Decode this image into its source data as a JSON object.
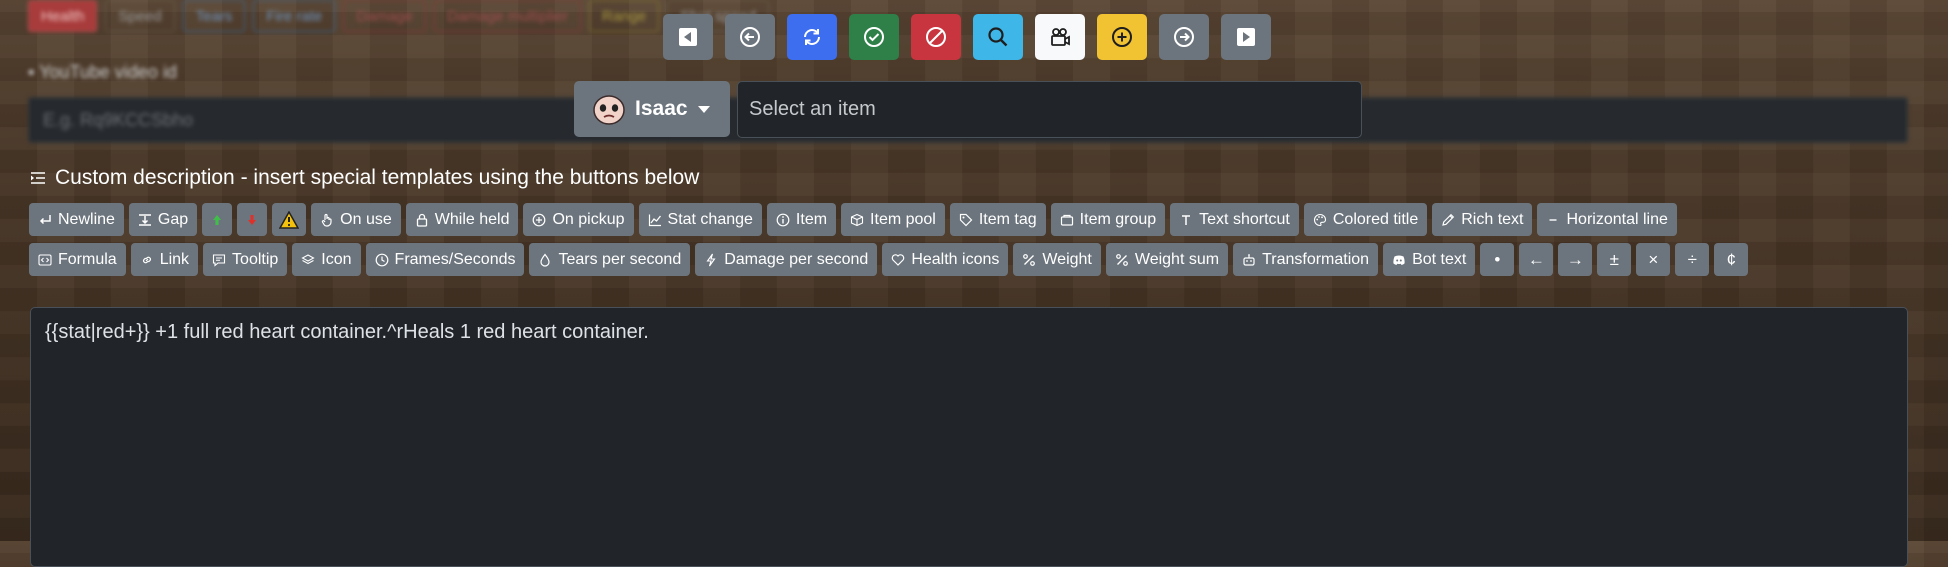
{
  "background": {
    "tags": [
      {
        "label": "Health",
        "style": "red"
      },
      {
        "label": "Speed",
        "style": "plain"
      },
      {
        "label": "Tears",
        "style": "blue"
      },
      {
        "label": "Fire rate",
        "style": "blue"
      },
      {
        "label": "Damage",
        "style": "redo"
      },
      {
        "label": "Damage multiplier",
        "style": "redo"
      },
      {
        "label": "Range",
        "style": "yellow"
      },
      {
        "label": "Shot speed",
        "style": "plain"
      }
    ],
    "youtube_label": "YouTube video id",
    "youtube_placeholder": "E.g. Rq9KCCSbho"
  },
  "toolbar": {
    "buttons": [
      {
        "name": "first-item",
        "icon": "skip-back-icon",
        "color": "#6c757d"
      },
      {
        "name": "previous-item",
        "icon": "arrow-left-circle-icon",
        "color": "#6c757d"
      },
      {
        "name": "reload",
        "icon": "refresh-icon",
        "color": "#3d6ef0"
      },
      {
        "name": "approve",
        "icon": "check-circle-icon",
        "color": "#2e8048"
      },
      {
        "name": "reject",
        "icon": "ban-icon",
        "color": "#c9353f"
      },
      {
        "name": "search",
        "icon": "search-icon",
        "color": "#3fb6e8"
      },
      {
        "name": "video",
        "icon": "camera-reels-icon",
        "color": "#f8f9fa"
      },
      {
        "name": "add",
        "icon": "plus-circle-icon",
        "color": "#f1c232"
      },
      {
        "name": "next-item",
        "icon": "arrow-right-circle-icon",
        "color": "#6c757d"
      },
      {
        "name": "last-item",
        "icon": "skip-forward-icon",
        "color": "#6c757d"
      }
    ]
  },
  "character": {
    "name": "Isaac",
    "icon": "isaac-face-icon"
  },
  "item_select": {
    "placeholder": "Select an item"
  },
  "description": {
    "title": "Custom description - insert special templates using the buttons below",
    "text": "{{stat|red+}} +1 full red heart container.^rHeals 1 red heart container."
  },
  "templates": {
    "row1": [
      {
        "label": "Newline",
        "icon": "newline-icon"
      },
      {
        "label": "Gap",
        "icon": "gap-icon"
      },
      {
        "label": "",
        "icon": "arrow-up-green-icon"
      },
      {
        "label": "",
        "icon": "arrow-down-red-icon"
      },
      {
        "label": "",
        "icon": "warning-icon"
      },
      {
        "label": "On use",
        "icon": "hand-icon"
      },
      {
        "label": "While held",
        "icon": "lock-icon"
      },
      {
        "label": "On pickup",
        "icon": "plus-circle-icon"
      },
      {
        "label": "Stat change",
        "icon": "graph-icon"
      },
      {
        "label": "Item",
        "icon": "info-icon"
      },
      {
        "label": "Item pool",
        "icon": "box-icon"
      },
      {
        "label": "Item tag",
        "icon": "tag-icon"
      },
      {
        "label": "Item group",
        "icon": "folder-icon"
      },
      {
        "label": "Text shortcut",
        "icon": "t-icon"
      },
      {
        "label": "Colored title",
        "icon": "palette-icon"
      },
      {
        "label": "Rich text",
        "icon": "pencil-icon"
      },
      {
        "label": "Horizontal line",
        "icon": "dash-icon"
      }
    ],
    "row2": [
      {
        "label": "Formula",
        "icon": "code-icon"
      },
      {
        "label": "Link",
        "icon": "link-icon"
      },
      {
        "label": "Tooltip",
        "icon": "chat-icon"
      },
      {
        "label": "Icon",
        "icon": "layers-icon"
      },
      {
        "label": "Frames/Seconds",
        "icon": "clock-icon"
      },
      {
        "label": "Tears per second",
        "icon": "drop-icon"
      },
      {
        "label": "Damage per second",
        "icon": "lightning-icon"
      },
      {
        "label": "Health icons",
        "icon": "heart-icon"
      },
      {
        "label": "Weight",
        "icon": "percent-icon"
      },
      {
        "label": "Weight sum",
        "icon": "percent-icon"
      },
      {
        "label": "Transformation",
        "icon": "robot-icon"
      },
      {
        "label": "Bot text",
        "icon": "discord-icon"
      }
    ],
    "symbols": [
      "•",
      "←",
      "→",
      "±",
      "×",
      "÷",
      "¢"
    ]
  }
}
